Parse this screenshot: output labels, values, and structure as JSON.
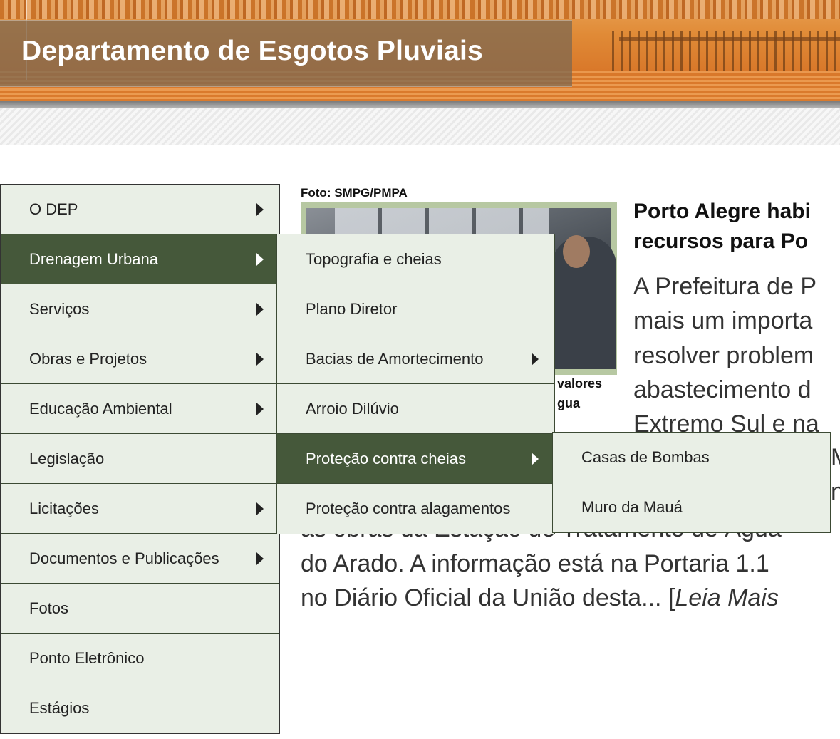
{
  "header": {
    "title": "Departamento de Esgotos Pluviais"
  },
  "news": {
    "photo_caption": "Foto: SMPG/PMPA",
    "photo_text": [
      "valores",
      "gua"
    ],
    "title_lines": [
      "Porto Alegre habi",
      "recursos para Po"
    ],
    "body_lines": [
      "A Prefeitura de P",
      "mais um importa",
      "resolver problem",
      "abastecimento d",
      "Extremo Sul e na",
      "Mi",
      "n",
      "as obras da Estação de Tratamento de Água",
      "do Arado. A informação está na Portaria 1.1",
      "no Diário Oficial da União desta... ["
    ],
    "read_more": "Leia Mais"
  },
  "main_menu": {
    "items": [
      {
        "label": "O DEP",
        "has_submenu": true
      },
      {
        "label": "Drenagem Urbana",
        "has_submenu": true,
        "active": true
      },
      {
        "label": "Serviços",
        "has_submenu": true
      },
      {
        "label": "Obras e Projetos",
        "has_submenu": true
      },
      {
        "label": "Educação Ambiental",
        "has_submenu": true
      },
      {
        "label": "Legislação",
        "has_submenu": false
      },
      {
        "label": "Licitações",
        "has_submenu": true
      },
      {
        "label": "Documentos e Publicações",
        "has_submenu": true
      },
      {
        "label": "Fotos",
        "has_submenu": false
      },
      {
        "label": "Ponto Eletrônico",
        "has_submenu": false
      },
      {
        "label": "Estágios",
        "has_submenu": false
      }
    ]
  },
  "drenagem_menu": {
    "items": [
      {
        "label": "Topografia e cheias",
        "has_submenu": false
      },
      {
        "label": "Plano Diretor",
        "has_submenu": false
      },
      {
        "label": "Bacias de Amortecimento",
        "has_submenu": true
      },
      {
        "label": "Arroio Dilúvio",
        "has_submenu": false
      },
      {
        "label": "Proteção contra cheias",
        "has_submenu": true,
        "active": true
      },
      {
        "label": "Proteção contra alagamentos",
        "has_submenu": false
      }
    ]
  },
  "protecao_menu": {
    "items": [
      {
        "label": "Casas de Bombas",
        "has_submenu": false
      },
      {
        "label": "Muro da Mauá",
        "has_submenu": false
      }
    ]
  },
  "colors": {
    "menu_bg": "#e9efe6",
    "menu_active_bg": "#45583a",
    "banner_orange": "#e08a36"
  },
  "icons": {
    "submenu_indicator": "triangle-right-icon"
  }
}
